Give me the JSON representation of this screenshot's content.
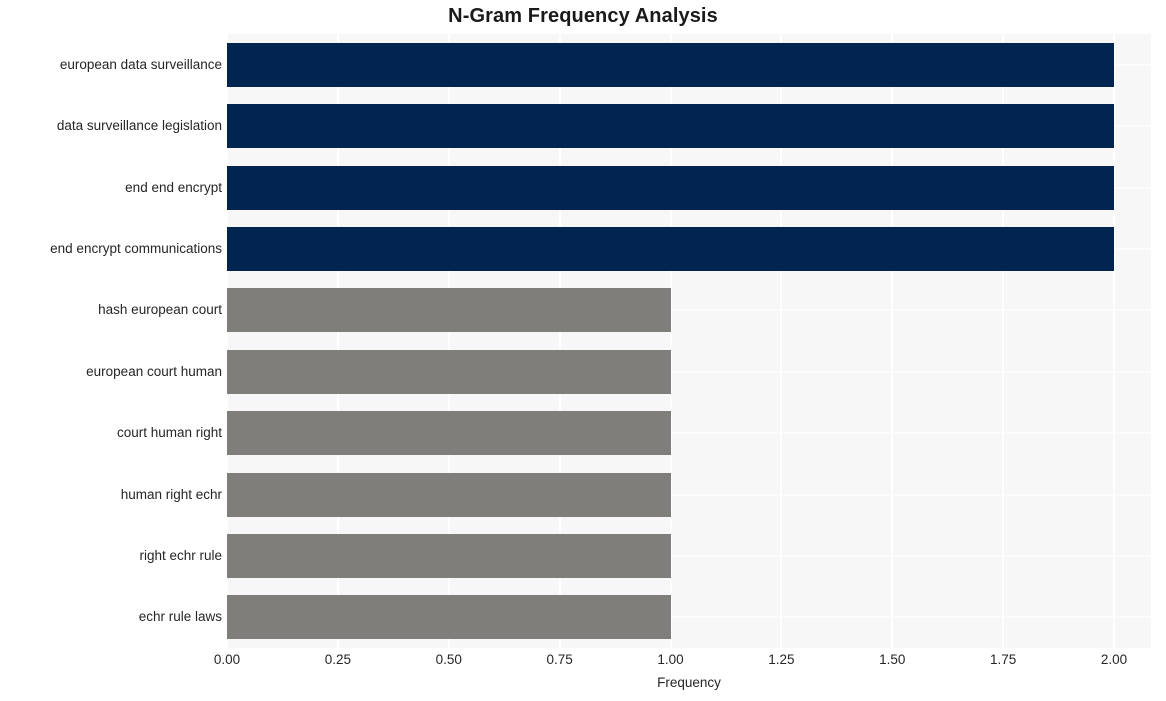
{
  "chart_data": {
    "type": "bar",
    "orientation": "horizontal",
    "title": "N-Gram Frequency Analysis",
    "xlabel": "Frequency",
    "ylabel": "",
    "xlim": [
      0,
      2
    ],
    "xticks": [
      "0.00",
      "0.25",
      "0.50",
      "0.75",
      "1.00",
      "1.25",
      "1.50",
      "1.75",
      "2.00"
    ],
    "xtick_values": [
      0,
      0.25,
      0.5,
      0.75,
      1.0,
      1.25,
      1.5,
      1.75,
      2.0
    ],
    "grid": true,
    "legend": "none",
    "categories": [
      "european data surveillance",
      "data surveillance legislation",
      "end end encrypt",
      "end encrypt communications",
      "hash european court",
      "european court human",
      "court human right",
      "human right echr",
      "right echr rule",
      "echr rule laws"
    ],
    "values": [
      2,
      2,
      2,
      2,
      1,
      1,
      1,
      1,
      1,
      1
    ],
    "bar_colors": [
      "#022550",
      "#022550",
      "#022550",
      "#022550",
      "#7f7e7b",
      "#7f7e7b",
      "#7f7e7b",
      "#7f7e7b",
      "#7f7e7b",
      "#7f7e7b"
    ],
    "colors": {
      "high_frequency": "#022550",
      "low_frequency": "#7f7e7b",
      "plot_background": "#f7f7f7",
      "figure_background": "#ffffff",
      "gridline": "#ffffff",
      "text": "#262626",
      "title": "#1a1a1a"
    }
  }
}
